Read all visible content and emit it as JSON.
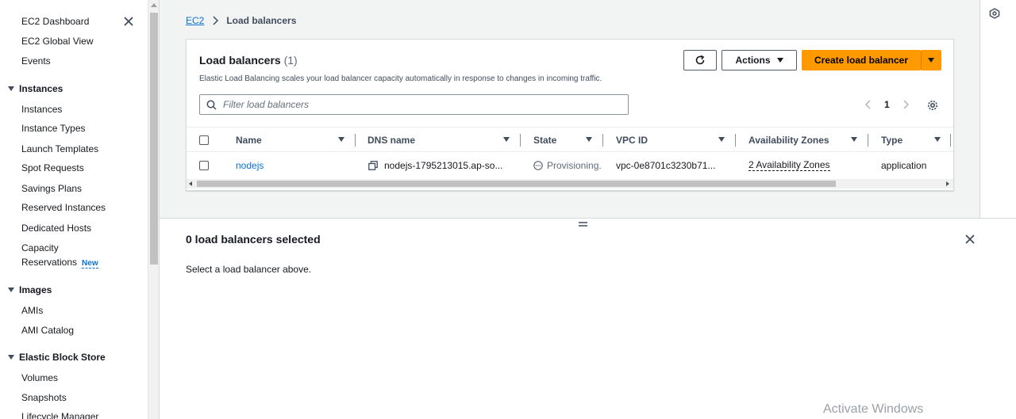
{
  "sidebar": {
    "top_links": [
      "EC2 Dashboard",
      "EC2 Global View",
      "Events"
    ],
    "sections": [
      {
        "title": "Instances",
        "items": [
          "Instances",
          "Instance Types",
          "Launch Templates",
          "Spot Requests",
          "Savings Plans",
          "Reserved Instances",
          "Dedicated Hosts"
        ]
      },
      {
        "title": "Images",
        "items": [
          "AMIs",
          "AMI Catalog"
        ]
      },
      {
        "title": "Elastic Block Store",
        "items": [
          "Volumes",
          "Snapshots",
          "Lifecycle Manager"
        ]
      }
    ],
    "capacity": {
      "line1": "Capacity",
      "line2": "Reservations",
      "badge": "New"
    }
  },
  "breadcrumb": {
    "root": "EC2",
    "current": "Load balancers"
  },
  "panel": {
    "title": "Load balancers",
    "count": "(1)",
    "description": "Elastic Load Balancing scales your load balancer capacity automatically in response to changes in incoming traffic.",
    "actions_label": "Actions",
    "create_label": "Create load balancer",
    "filter_placeholder": "Filter load balancers",
    "page": "1"
  },
  "table": {
    "columns": [
      "Name",
      "DNS name",
      "State",
      "VPC ID",
      "Availability Zones",
      "Type"
    ],
    "rows": [
      {
        "name": "nodejs",
        "dns": "nodejs-1795213015.ap-so...",
        "state": "Provisioning.",
        "vpc": "vpc-0e8701c3230b71...",
        "az": "2 Availability Zones",
        "type": "application"
      }
    ]
  },
  "split_panel": {
    "title": "0 load balancers selected",
    "text": "Select a load balancer above."
  },
  "watermark": "Activate Windows",
  "colors": {
    "primary": "#ff9900",
    "link": "#0972d3",
    "bg": "#f2f3f3"
  }
}
